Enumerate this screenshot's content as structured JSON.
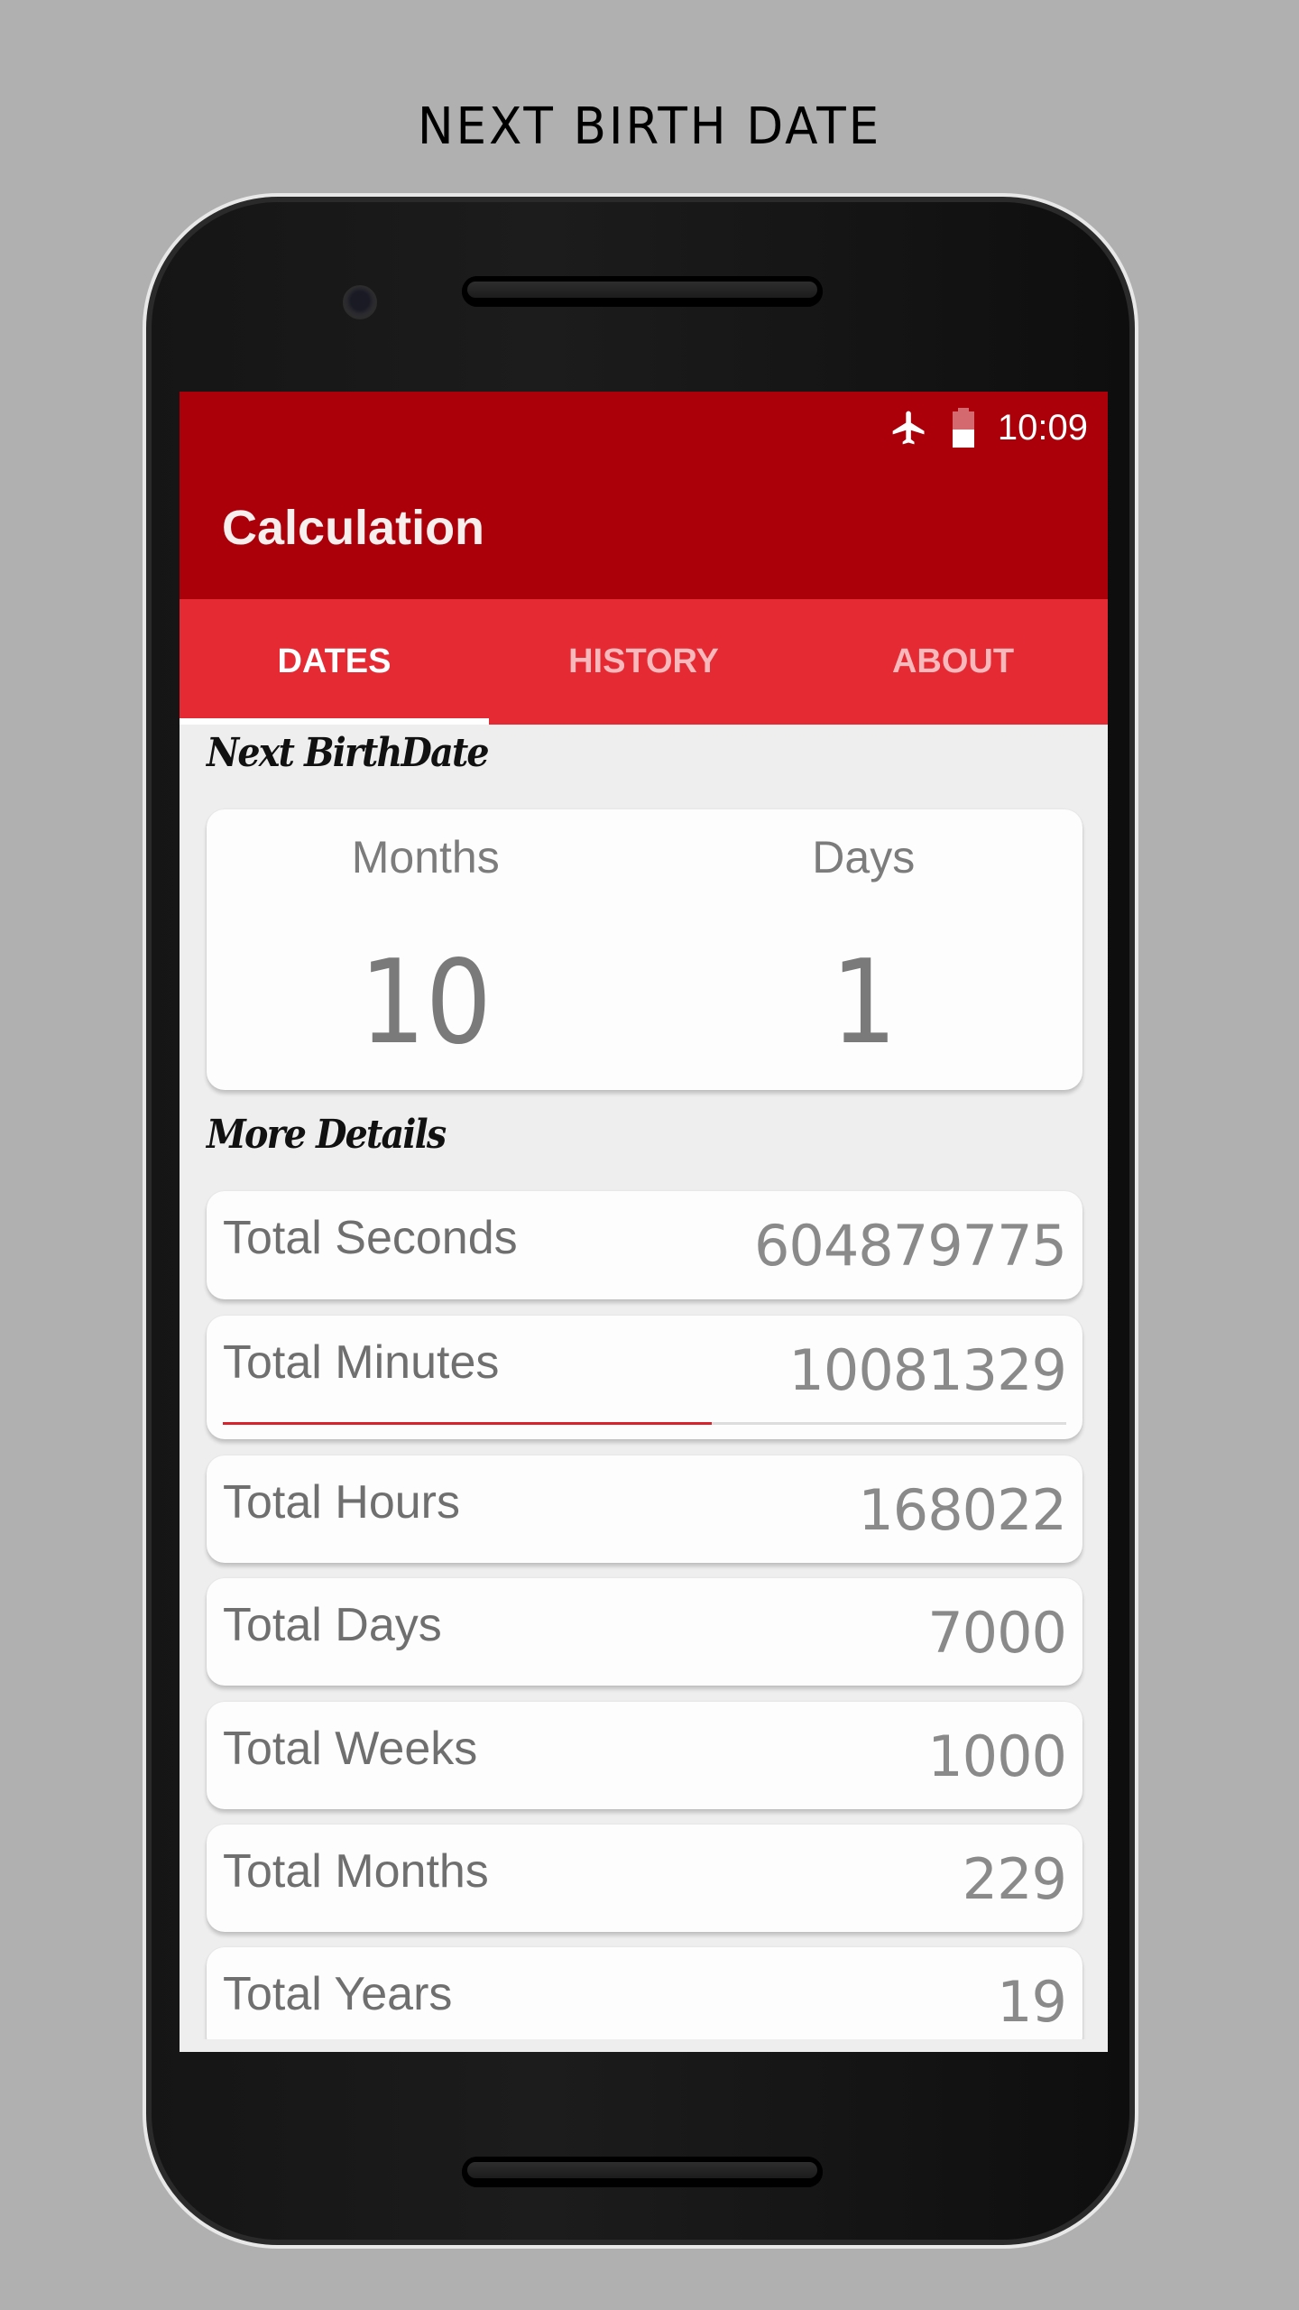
{
  "caption": "NEXT BIRTH DATE",
  "status_bar": {
    "time": "10:09",
    "icons": [
      "airplane-mode-icon",
      "battery-icon"
    ],
    "battery_level": 0.5
  },
  "toolbar": {
    "title": "Calculation"
  },
  "tabs": [
    {
      "label": "DATES",
      "active": true
    },
    {
      "label": "HISTORY",
      "active": false
    },
    {
      "label": "ABOUT",
      "active": false
    }
  ],
  "next_birthdate": {
    "heading": "Next BirthDate",
    "months_label": "Months",
    "months_value": "10",
    "days_label": "Days",
    "days_value": "1"
  },
  "more_details": {
    "heading": "More Details",
    "rows": [
      {
        "label": "Total Seconds",
        "value": "604879775"
      },
      {
        "label": "Total Minutes",
        "value": "10081329",
        "progress": 0.58
      },
      {
        "label": "Total Hours",
        "value": "168022"
      },
      {
        "label": "Total Days",
        "value": "7000"
      },
      {
        "label": "Total Weeks",
        "value": "1000"
      },
      {
        "label": "Total Months",
        "value": "229"
      },
      {
        "label": "Total Years",
        "value": "19"
      }
    ]
  },
  "colors": {
    "primary_dark": "#ab0009",
    "primary": "#e52a33",
    "accent": "#d8232d",
    "background": "#eeeeee"
  }
}
